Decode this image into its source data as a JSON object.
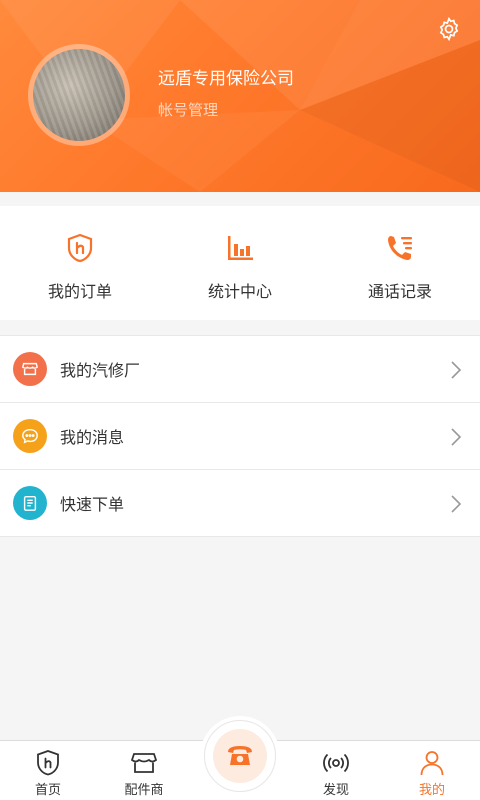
{
  "profile": {
    "company": "远盾专用保险公司",
    "account_link": "帐号管理"
  },
  "quick_menu": [
    {
      "label": "我的订单",
      "icon": "shield-order-icon"
    },
    {
      "label": "统计中心",
      "icon": "bar-chart-icon"
    },
    {
      "label": "通话记录",
      "icon": "phone-list-icon"
    }
  ],
  "menu_list": [
    {
      "label": "我的汽修厂",
      "icon": "shop-icon",
      "color": "#f2704a"
    },
    {
      "label": "我的消息",
      "icon": "chat-bubble-icon",
      "color": "#f5a21a"
    },
    {
      "label": "快速下单",
      "icon": "clipboard-icon",
      "color": "#22b3cf"
    }
  ],
  "tabs": [
    {
      "label": "首页",
      "icon": "home-shield-icon"
    },
    {
      "label": "配件商",
      "icon": "shop-icon"
    },
    {
      "label": "发现",
      "icon": "broadcast-icon"
    },
    {
      "label": "我的",
      "icon": "user-icon"
    }
  ],
  "colors": {
    "accent": "#f7732a",
    "header_start": "#ff8a3d",
    "header_end": "#f86a1e"
  }
}
